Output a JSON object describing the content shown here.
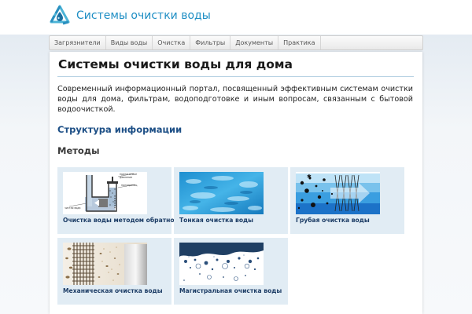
{
  "site": {
    "title": "Системы очистки воды",
    "logo_icon": "recycle-water-drop-icon",
    "accent_color": "#1e8ec4"
  },
  "nav": {
    "items": [
      {
        "label": "Загрязнители"
      },
      {
        "label": "Виды воды"
      },
      {
        "label": "Очистка"
      },
      {
        "label": "Фильтры"
      },
      {
        "label": "Документы"
      },
      {
        "label": "Практика"
      }
    ]
  },
  "main": {
    "title": "Системы очистки воды для дома",
    "intro": "Современный информационный портал, посвященный эффективным системам очистки воды для дома, фильтрам, водоподготовке и иным вопросам, связанным с бытовой водоочисткой.",
    "structure_heading": "Структура информации",
    "methods_heading": "Методы",
    "methods": [
      {
        "caption": "Очистка воды методом обратного",
        "image": "reverse-osmosis-diagram"
      },
      {
        "caption": "Тонкая очистка воды",
        "image": "blue-water-texture"
      },
      {
        "caption": "Грубая очистка воды",
        "image": "coarse-filter-diagram"
      },
      {
        "caption": "Механическая очистка воды",
        "image": "mechanical-filter-mesh"
      },
      {
        "caption": "Магистральная очистка воды",
        "image": "mainline-filter-micrograph"
      }
    ]
  }
}
